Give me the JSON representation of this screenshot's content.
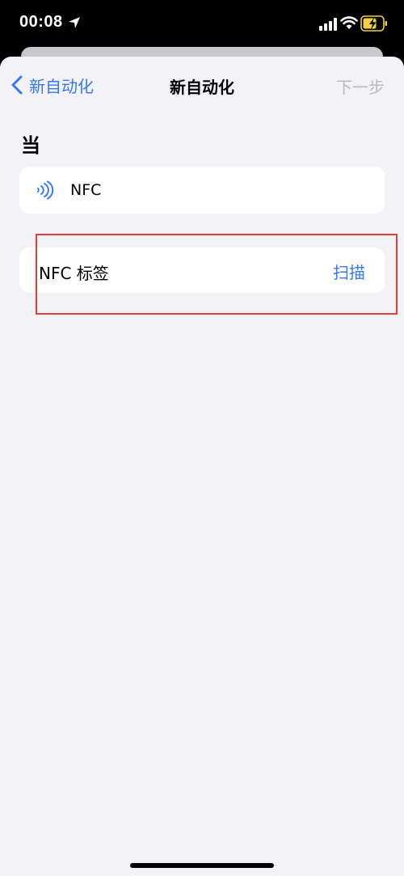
{
  "status_bar": {
    "time": "00:08",
    "icons": [
      "location-arrow-icon",
      "cellular-signal-icon",
      "wifi-icon",
      "battery-charging-icon"
    ]
  },
  "nav": {
    "back_label": "新自动化",
    "title": "新自动化",
    "next_label": "下一步"
  },
  "section": {
    "heading": "当"
  },
  "trigger": {
    "icon": "nfc-icon",
    "label": "NFC"
  },
  "tag_row": {
    "label": "NFC 标签",
    "action_label": "扫描"
  },
  "colors": {
    "accent": "#3478f6",
    "background": "#f2f2f7",
    "disabled": "#b8b8bd",
    "annotation": "#e0403a"
  }
}
